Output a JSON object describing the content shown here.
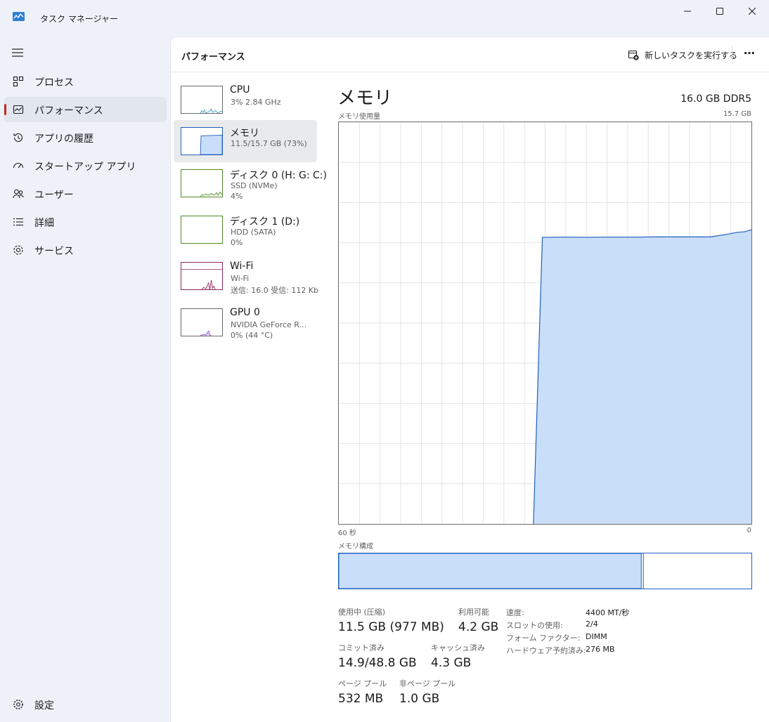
{
  "window": {
    "title": "タスク マネージャー"
  },
  "sidebar": {
    "items": [
      {
        "label": "プロセス",
        "icon": "processes-icon"
      },
      {
        "label": "パフォーマンス",
        "icon": "performance-icon",
        "active": true
      },
      {
        "label": "アプリの履歴",
        "icon": "app-history-icon"
      },
      {
        "label": "スタートアップ アプリ",
        "icon": "startup-icon"
      },
      {
        "label": "ユーザー",
        "icon": "users-icon"
      },
      {
        "label": "詳細",
        "icon": "details-icon"
      },
      {
        "label": "サービス",
        "icon": "services-icon"
      }
    ],
    "settings_label": "設定"
  },
  "header": {
    "title": "パフォーマンス",
    "run_task_label": "新しいタスクを実行する"
  },
  "devices": [
    {
      "name": "CPU",
      "line1": "3%  2.84 GHz",
      "line2": ""
    },
    {
      "name": "メモリ",
      "line1": "11.5/15.7 GB (73%)",
      "line2": ""
    },
    {
      "name": "ディスク 0 (H: G: C:)",
      "line1": "SSD (NVMe)",
      "line2": "4%"
    },
    {
      "name": "ディスク 1 (D:)",
      "line1": "HDD (SATA)",
      "line2": "0%"
    },
    {
      "name": "Wi-Fi",
      "line1": "Wi-Fi",
      "line2": "送信: 16.0  受信: 112 Kbp"
    },
    {
      "name": "GPU 0",
      "line1": "NVIDIA GeForce R...",
      "line2": "0%  (44 °C)"
    }
  ],
  "memory": {
    "title": "メモリ",
    "spec": "16.0 GB DDR5",
    "usage_label": "メモリ使用量",
    "max_label": "15.7 GB",
    "x_left": "60 秒",
    "x_right": "0",
    "composition_label": "メモリ構成",
    "composition_in_use_fraction": 0.733,
    "stats": {
      "in_use_label": "使用中 (圧縮)",
      "in_use_value": "11.5 GB (977 MB)",
      "available_label": "利用可能",
      "available_value": "4.2 GB",
      "committed_label": "コミット済み",
      "committed_value": "14.9/48.8 GB",
      "cached_label": "キャッシュ済み",
      "cached_value": "4.3 GB",
      "paged_label": "ページ プール",
      "paged_value": "532 MB",
      "nonpaged_label": "非ページ プール",
      "nonpaged_value": "1.0 GB"
    },
    "details": [
      {
        "key": "速度:",
        "value": "4400 MT/秒"
      },
      {
        "key": "スロットの使用:",
        "value": "2/4"
      },
      {
        "key": "フォーム ファクター:",
        "value": "DIMM"
      },
      {
        "key": "ハードウェア予約済み:",
        "value": "276 MB"
      }
    ]
  },
  "chart_data": {
    "type": "area",
    "title": "メモリ使用量",
    "x_range_seconds": [
      60,
      0
    ],
    "ylim_gb": [
      0,
      15.7
    ],
    "series": [
      {
        "x": [
          60,
          58,
          56,
          54,
          52,
          50,
          48,
          46,
          44,
          42,
          40,
          38,
          36,
          34,
          32,
          31.7,
          30.4,
          30,
          28,
          26,
          24,
          22,
          20,
          18,
          16,
          14,
          12,
          10,
          8,
          6,
          4,
          2,
          1,
          0
        ],
        "values": [
          null,
          null,
          null,
          null,
          null,
          null,
          null,
          null,
          null,
          null,
          null,
          null,
          null,
          null,
          null,
          0,
          11.2,
          11.2,
          11.21,
          11.21,
          11.2,
          11.21,
          11.21,
          11.21,
          11.21,
          11.22,
          11.22,
          11.22,
          11.22,
          11.22,
          11.3,
          11.4,
          11.42,
          11.5
        ]
      }
    ],
    "colors": {
      "fill": "#c9def8",
      "line": "#2060c0",
      "grid": "#e4e4e4"
    }
  },
  "colors": {
    "accent": "#2060c0",
    "active_indicator": "#c42b1c"
  }
}
